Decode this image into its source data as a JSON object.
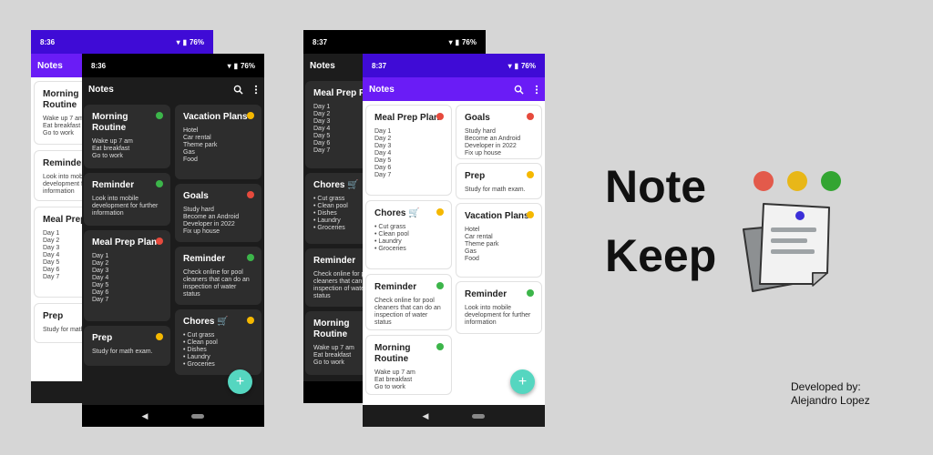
{
  "colors": {
    "red": "#e64a3d",
    "yellow": "#f5b800",
    "green": "#3cb54a",
    "purple": "#6a1cf6",
    "teal": "#55d6c0"
  },
  "icons": {
    "search": "search-icon",
    "more": "more-vert-icon",
    "wifi": "wifi-icon",
    "battery": "battery-icon",
    "back": "nav-back-icon",
    "add": "add-icon"
  },
  "phones": [
    {
      "time": "8:36",
      "battery": "76%",
      "title": "Notes",
      "notes": [
        {
          "title": "Morning Routine",
          "body": "Wake up 7 am\nEat breakfast\nGo to work"
        },
        {
          "title": "Reminder",
          "body": "Look into mobile development for further information"
        },
        {
          "title": "Meal Prep Plan",
          "body": "Day 1\nDay 2\nDay 3\nDay 4\nDay 5\nDay 6\nDay 7"
        },
        {
          "title": "Prep",
          "body": "Study for math exam."
        }
      ]
    },
    {
      "time": "8:36",
      "battery": "76%",
      "title": "Notes",
      "fab": "+",
      "notes": [
        {
          "title": "Morning Routine",
          "body": "Wake up 7 am\nEat breakfast\nGo to work"
        },
        {
          "title": "Reminder",
          "body": "Look into mobile development for further information"
        },
        {
          "title": "Meal Prep Plan",
          "body": "Day 1\nDay 2\nDay 3\nDay 4\nDay 5\nDay 6\nDay 7"
        },
        {
          "title": "Prep",
          "body": "Study for math exam."
        },
        {
          "title": "Vacation Plans",
          "body": "Hotel\nCar rental\nTheme park\nGas\nFood"
        },
        {
          "title": "Goals",
          "body": "Study hard\nBecome an Android Developer in 2022\nFix up house"
        },
        {
          "title": "Reminder",
          "body": "Check online for pool cleaners that can do an inspection of water status"
        },
        {
          "title": "Chores 🛒",
          "body": "• Cut grass\n• Clean pool\n• Dishes\n• Laundry\n• Groceries"
        }
      ]
    },
    {
      "time": "8:37",
      "battery": "76%",
      "title": "Notes",
      "notes": [
        {
          "title": "Meal Prep Plan",
          "body": "Day 1\nDay 2\nDay 3\nDay 4\nDay 5\nDay 6\nDay 7"
        },
        {
          "title": "Chores 🛒",
          "body": "• Cut grass\n• Clean pool\n• Dishes\n• Laundry\n• Groceries"
        },
        {
          "title": "Reminder",
          "body": "Check online for pool cleaners that can do an inspection of water status"
        },
        {
          "title": "Morning Routine",
          "body": "Wake up 7 am\nEat breakfast\nGo to work"
        }
      ]
    },
    {
      "time": "8:37",
      "battery": "76%",
      "title": "Notes",
      "fab": "+",
      "notes": [
        {
          "title": "Meal Prep Plan",
          "body": "Day 1\nDay 2\nDay 3\nDay 4\nDay 5\nDay 6\nDay 7"
        },
        {
          "title": "Chores 🛒",
          "body": "• Cut grass\n• Clean pool\n• Laundry\n• Groceries"
        },
        {
          "title": "Reminder",
          "body": "Check online for pool cleaners that can do an inspection of water status"
        },
        {
          "title": "Morning Routine",
          "body": "Wake up 7 am\nEat breakfast\nGo to work"
        },
        {
          "title": "Goals",
          "body": "Study hard\nBecome an Android Developer in 2022\nFix up house"
        },
        {
          "title": "Prep",
          "body": "Study for math exam."
        },
        {
          "title": "Vacation Plans",
          "body": "Hotel\nCar rental\nTheme park\nGas\nFood"
        },
        {
          "title": "Reminder",
          "body": "Look into mobile development for further information"
        }
      ]
    }
  ],
  "logo": {
    "word1": "Note",
    "word2": "Keep"
  },
  "credit": {
    "label": "Developed by:",
    "name": "Alejandro Lopez"
  }
}
